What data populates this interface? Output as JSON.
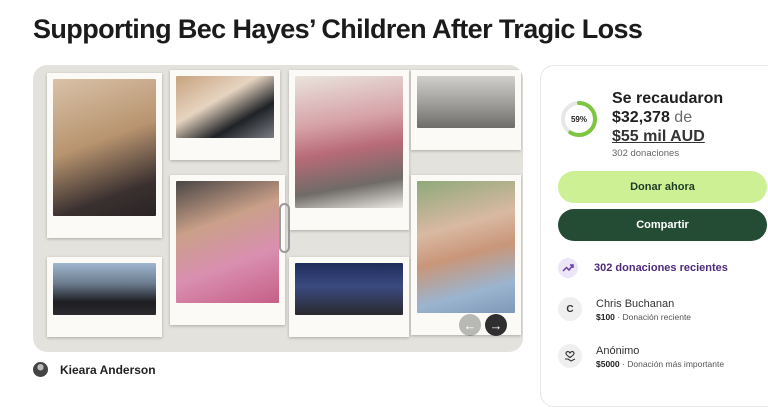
{
  "title": "Supporting Bec Hayes’ Children After Tragic Loss",
  "gallery": {
    "prev_glyph": "←",
    "next_glyph": "→",
    "icons": {
      "prev": "arrow-left-icon",
      "next": "arrow-right-icon"
    }
  },
  "organizer": {
    "name": "Kieara Anderson"
  },
  "donation": {
    "progress_percent": 59,
    "progress_label": "59%",
    "heading": "Se recaudaron",
    "raised": "$32,378",
    "de": "de",
    "goal": "$55 mil AUD",
    "donations_count": "302 donaciones",
    "donate_button": "Donar ahora",
    "share_button": "Compartir",
    "recent_donations": "302 donaciones recientes",
    "donors": [
      {
        "initial": "C",
        "name": "Chris Buchanan",
        "amount": "$100",
        "detail": "Donación reciente"
      },
      {
        "initial": "",
        "name": "Anónimo",
        "amount": "$5000",
        "detail": "Donación más importante"
      }
    ],
    "separator": "·",
    "colors": {
      "accent": "#cdf095",
      "primary_dark": "#244c35",
      "progress": "#7dc640",
      "recent": "#4d2a7a"
    }
  }
}
